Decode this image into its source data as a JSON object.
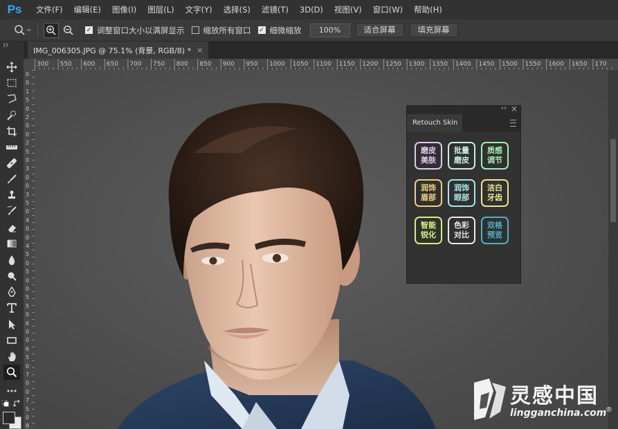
{
  "app": {
    "logo": "Ps"
  },
  "menu": [
    "文件(F)",
    "编辑(E)",
    "图像(I)",
    "图层(L)",
    "文字(Y)",
    "选择(S)",
    "滤镜(T)",
    "3D(D)",
    "视图(V)",
    "窗口(W)",
    "帮助(H)"
  ],
  "options": {
    "resize_windows_label": "调整窗口大小以满屏显示",
    "zoom_all_label": "缩放所有窗口",
    "scrubby_label": "细微缩放",
    "zoom_value": "100%",
    "fit_screen_label": "适合屏幕",
    "fill_screen_label": "填充屏幕"
  },
  "document": {
    "tab_title": "IMG_006305.JPG @ 75.1% (背景, RGB/8) *",
    "close_glyph": "×"
  },
  "ruler": {
    "h_labels": [
      "300",
      "550",
      "600",
      "650",
      "700",
      "750",
      "800",
      "850",
      "900",
      "950",
      "1000",
      "1050",
      "1100",
      "1150",
      "1200",
      "1250",
      "1300",
      "1350",
      "1400",
      "1450",
      "1500",
      "1550",
      "1600",
      "1650",
      "170"
    ],
    "v_labels": [
      "0",
      "0",
      "1",
      "5",
      "0",
      "2",
      "0",
      "0",
      "2",
      "5",
      "0",
      "3",
      "0",
      "0",
      "3",
      "5",
      "0",
      "4",
      "0",
      "0",
      "4",
      "5",
      "0",
      "5",
      "0",
      "0",
      "5",
      "5",
      "0",
      "6",
      "0",
      "0",
      "6",
      "5",
      "0",
      "7",
      "0",
      "0",
      "7",
      "5",
      "0",
      "8"
    ]
  },
  "panel": {
    "title": "Retouch Skin",
    "collapse_glyph": "‹‹",
    "close_glyph": "×",
    "buttons": [
      {
        "line1": "磨皮",
        "line2": "美肤",
        "color": "#e3c8f0"
      },
      {
        "line1": "批量",
        "line2": "磨皮",
        "color": "#c8f0e0"
      },
      {
        "line1": "质感",
        "line2": "调节",
        "color": "#9ff0b0"
      },
      {
        "line1": "润饰",
        "line2": "眉部",
        "color": "#f0d080"
      },
      {
        "line1": "润饰",
        "line2": "眼部",
        "color": "#a8e8e8"
      },
      {
        "line1": "洁白",
        "line2": "牙齿",
        "color": "#f0e890"
      },
      {
        "line1": "智能",
        "line2": "锐化",
        "color": "#d8f080"
      },
      {
        "line1": "色彩",
        "line2": "对比",
        "color": "#e8e8e8"
      },
      {
        "line1": "双格",
        "line2": "预览",
        "color": "#4fb0c8"
      }
    ]
  },
  "watermark": {
    "brand_cn": "灵感中国",
    "brand_url": "lingganchina.com",
    "reg": "®"
  },
  "colors": {
    "ps_blue": "#31a8ff",
    "menu_bg": "#323232",
    "canvas_bg": "#4e4e4e"
  }
}
